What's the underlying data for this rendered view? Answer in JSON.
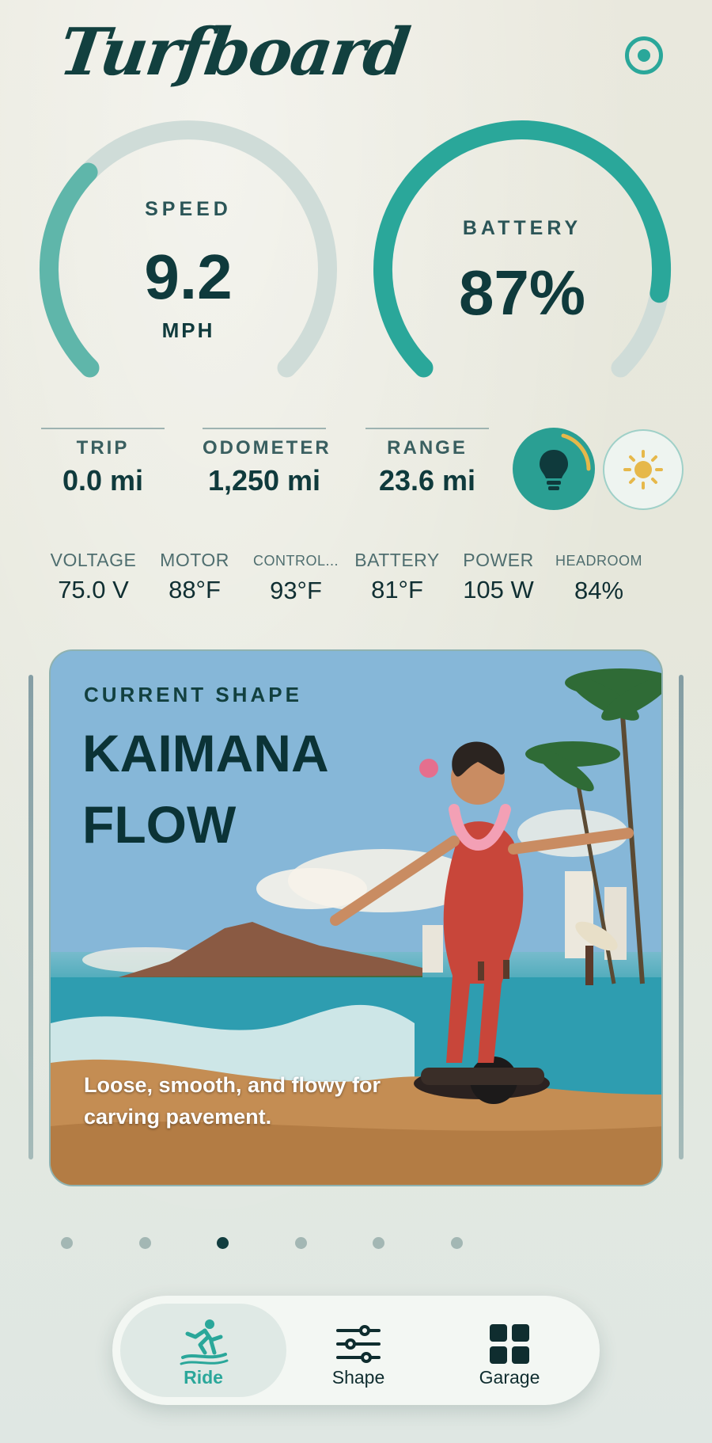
{
  "app": {
    "title": "Turfboard"
  },
  "gauges": {
    "speed": {
      "label": "SPEED",
      "value": "9.2",
      "unit": "MPH",
      "fraction": 0.33
    },
    "battery": {
      "label": "BATTERY",
      "value": "87%",
      "fraction": 0.87
    }
  },
  "stats": [
    {
      "label": "TRIP",
      "value": "0.0 mi"
    },
    {
      "label": "ODOMETER",
      "value": "1,250 mi"
    },
    {
      "label": "RANGE",
      "value": "23.6 mi"
    }
  ],
  "controls": {
    "headlight_icon": "lightbulb-icon",
    "brightness_icon": "sun-icon"
  },
  "telemetry": [
    {
      "label": "VOLTAGE",
      "value": "75.0 V"
    },
    {
      "label": "MOTOR",
      "value": "88°F"
    },
    {
      "label": "CONTROL...",
      "value": "93°F"
    },
    {
      "label": "BATTERY",
      "value": "81°F"
    },
    {
      "label": "POWER",
      "value": "105 W"
    },
    {
      "label": "HEADROOM",
      "value": "84%"
    }
  ],
  "shape_card": {
    "kicker": "CURRENT SHAPE",
    "title": "KAIMANA FLOW",
    "description": "Loose, smooth, and flowy for carving pavement."
  },
  "pager": {
    "count": 6,
    "active_index": 2
  },
  "tabs": [
    {
      "label": "Ride",
      "icon": "surfer-icon",
      "active": true
    },
    {
      "label": "Shape",
      "icon": "sliders-icon",
      "active": false
    },
    {
      "label": "Garage",
      "icon": "grid-icon",
      "active": false
    }
  ],
  "colors": {
    "accent": "#2aa79a",
    "dark": "#0f3a3c",
    "track": "#cfdcd8",
    "highlight": "#e6b84a"
  }
}
